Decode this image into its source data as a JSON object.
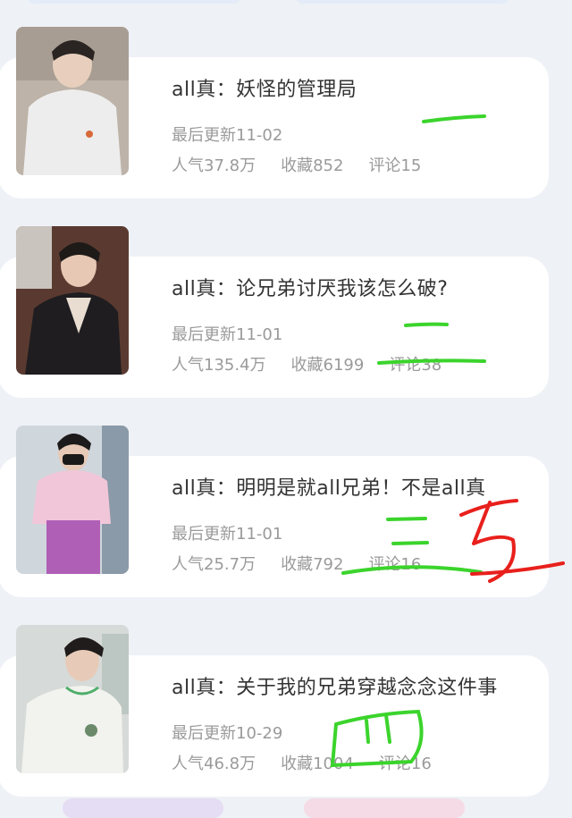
{
  "colors": {
    "title": "#333333",
    "meta": "#9a9a9a",
    "card": "#ffffff",
    "page_bg": "#eef1f6",
    "marker_green": "#3bd42c",
    "marker_red": "#e8201c"
  },
  "novels": [
    {
      "title": "all真：妖怪的管理局",
      "updated": "最后更新11-02",
      "popularity": "人气37.8万",
      "favorites": "收藏852",
      "comments": "评论15",
      "annotation": "一"
    },
    {
      "title": "all真：论兄弟讨厌我该怎么破?",
      "updated": "最后更新11-01",
      "popularity": "人气135.4万",
      "favorites": "收藏6199",
      "comments": "评论38",
      "annotation": "二"
    },
    {
      "title": "all真：明明是就all兄弟！不是all真",
      "updated": "最后更新11-01",
      "popularity": "人气25.7万",
      "favorites": "收藏792",
      "comments": "评论16",
      "annotation": "三"
    },
    {
      "title": "all真：关于我的兄弟穿越念念这件事",
      "updated": "最后更新10-29",
      "popularity": "人气46.8万",
      "favorites": "收藏1004",
      "comments": "评论16",
      "annotation": "四"
    }
  ],
  "red_annotation": "五"
}
